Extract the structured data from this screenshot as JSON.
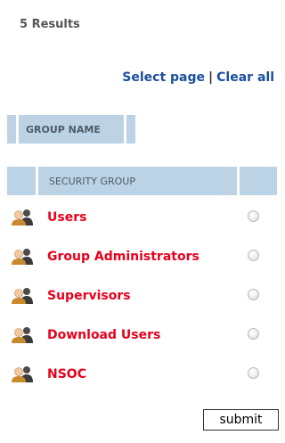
{
  "results": {
    "count_label": "5 Results"
  },
  "selection": {
    "select_page_label": "Select page",
    "separator": "|",
    "clear_all_label": "Clear all"
  },
  "group_table": {
    "column_header": "GROUP NAME"
  },
  "security_table": {
    "column_header": "SECURITY GROUP",
    "rows": [
      {
        "icon": "group-users-icon",
        "label": "Users",
        "selected": false
      },
      {
        "icon": "group-users-icon",
        "label": "Group Administrators",
        "selected": false
      },
      {
        "icon": "group-users-icon",
        "label": "Supervisors",
        "selected": false
      },
      {
        "icon": "group-users-icon",
        "label": "Download Users",
        "selected": false
      },
      {
        "icon": "group-users-icon",
        "label": "NSOC",
        "selected": false
      }
    ]
  },
  "form": {
    "submit_label": "submit"
  },
  "colors": {
    "link_blue": "#1a4f9c",
    "group_link_red": "#e8001c",
    "header_bg": "#bcd3e6",
    "header_text": "#4d5b66"
  }
}
